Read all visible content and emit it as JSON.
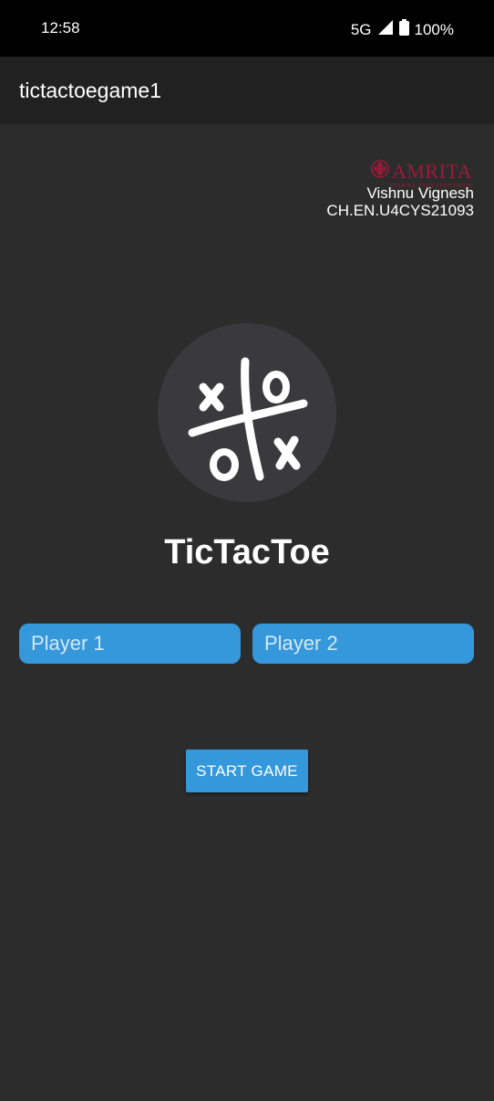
{
  "status_bar": {
    "time": "12:58",
    "network": "5G",
    "battery": "100%",
    "icons": [
      "signal-icon",
      "battery-icon"
    ]
  },
  "app_bar": {
    "title": "tictactoegame1"
  },
  "branding": {
    "logo_text": "AMRITA",
    "logo_subtext": "VISHWA VIDYAPEETHAM",
    "author_name": "Vishnu Vignesh",
    "author_id": "CH.EN.U4CYS21093"
  },
  "game": {
    "title": "TicTacToe",
    "logo_icon": "tictactoe-logo-icon"
  },
  "players": {
    "player1_placeholder": "Player 1",
    "player2_placeholder": "Player 2"
  },
  "actions": {
    "start_label": "START GAME"
  },
  "colors": {
    "background": "#2c2c2c",
    "app_bar": "#212121",
    "accent": "#3498db",
    "brand": "#9b1b3b"
  }
}
